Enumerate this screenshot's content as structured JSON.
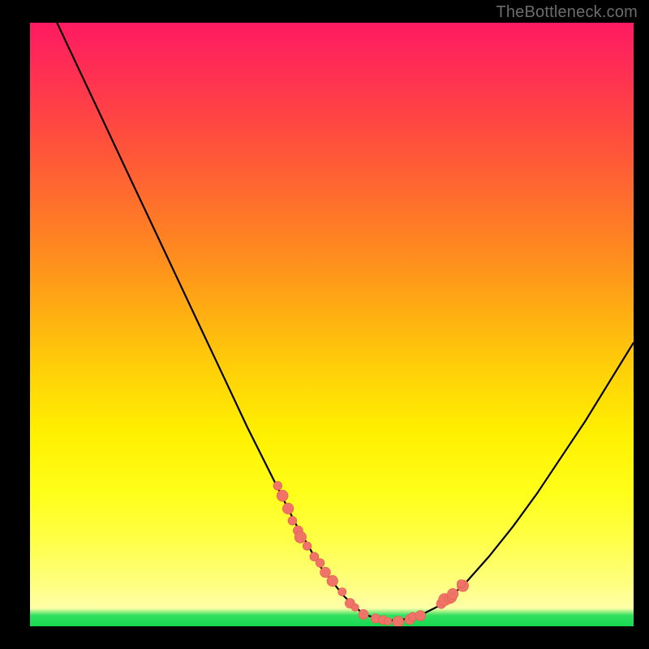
{
  "watermark": {
    "text": "TheBottleneck.com"
  },
  "colors": {
    "frame_bg": "#000000",
    "curve_stroke": "#000000",
    "marker_fill": "#ef7366",
    "marker_stroke": "#e65a4d"
  },
  "chart_data": {
    "type": "line",
    "title": "",
    "xlabel": "",
    "ylabel": "",
    "xlim": [
      0,
      100
    ],
    "ylim": [
      0,
      100
    ],
    "series": [
      {
        "name": "bottleneck-curve",
        "x": [
          0,
          4,
          8,
          12,
          16,
          20,
          24,
          28,
          32,
          36,
          40,
          44,
          48,
          52,
          55,
          58,
          61,
          64,
          68,
          72,
          76,
          80,
          84,
          88,
          92,
          96,
          100
        ],
        "y": [
          110,
          101,
          92.5,
          84,
          75.5,
          67,
          58.5,
          50,
          41.5,
          33,
          25,
          17,
          10,
          5,
          2.2,
          1,
          1,
          1.5,
          3.5,
          7,
          11.5,
          16.5,
          22,
          28,
          34,
          40.5,
          47
        ]
      }
    ],
    "markers": {
      "left_cluster": {
        "x_range": [
          41,
          48
        ],
        "y_range": [
          8.5,
          19
        ],
        "count": 9
      },
      "valley_cluster": {
        "x_range": [
          49,
          65
        ],
        "y_range": [
          0.8,
          3.2
        ],
        "count": 13
      },
      "right_cluster": {
        "x_range": [
          68,
          72
        ],
        "y_range": [
          3.5,
          8.5
        ],
        "count": 7
      }
    }
  }
}
